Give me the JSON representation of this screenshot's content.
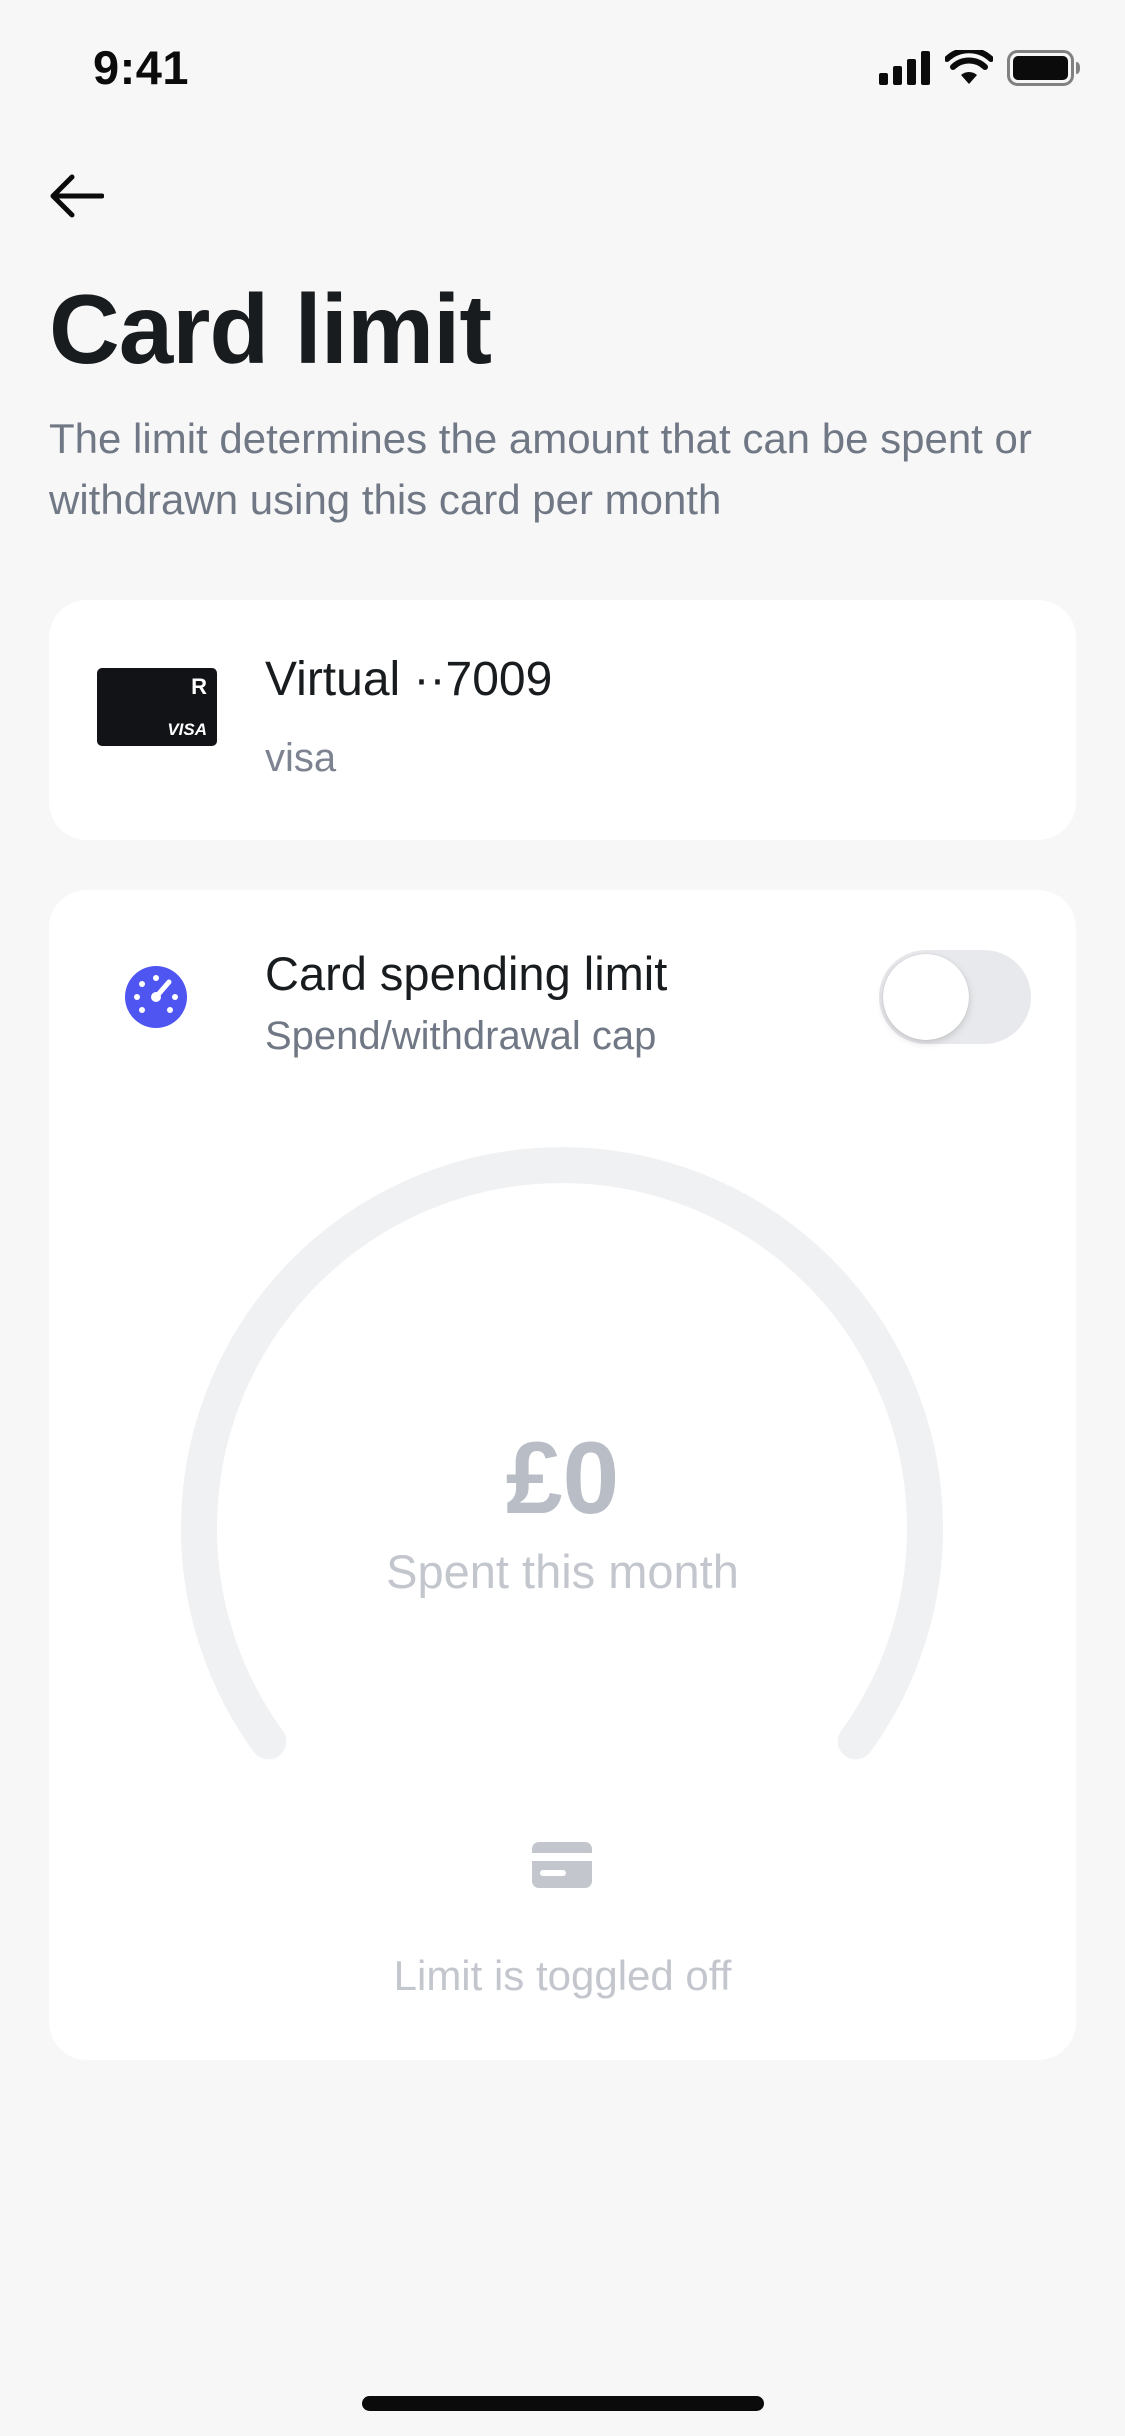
{
  "status_bar": {
    "time": "9:41",
    "icons": [
      "cellular-signal-icon",
      "wifi-icon",
      "battery-icon"
    ]
  },
  "header": {
    "back_icon": "arrow-left-icon",
    "title": "Card limit",
    "subtitle": "The limit determines the amount that can be spent or withdrawn using this card per month"
  },
  "card": {
    "name": "Virtual ··7009",
    "network": "visa",
    "thumb_logo": "R",
    "thumb_brand": "VISA"
  },
  "limit": {
    "title": "Card spending limit",
    "subtitle": "Spend/withdrawal cap",
    "icon": "speedometer-icon",
    "toggle_on": false,
    "amount": "£0",
    "amount_label": "Spent this month",
    "status_text": "Limit is toggled off",
    "status_icon": "card-icon",
    "progress_fraction": 0
  },
  "colors": {
    "background": "#f7f7f7",
    "panel": "#ffffff",
    "accent": "#4f55f1",
    "text_primary": "#191c1f",
    "text_secondary": "#717885",
    "muted": "#c3c7cd",
    "gauge_track": "#f0f1f3"
  }
}
